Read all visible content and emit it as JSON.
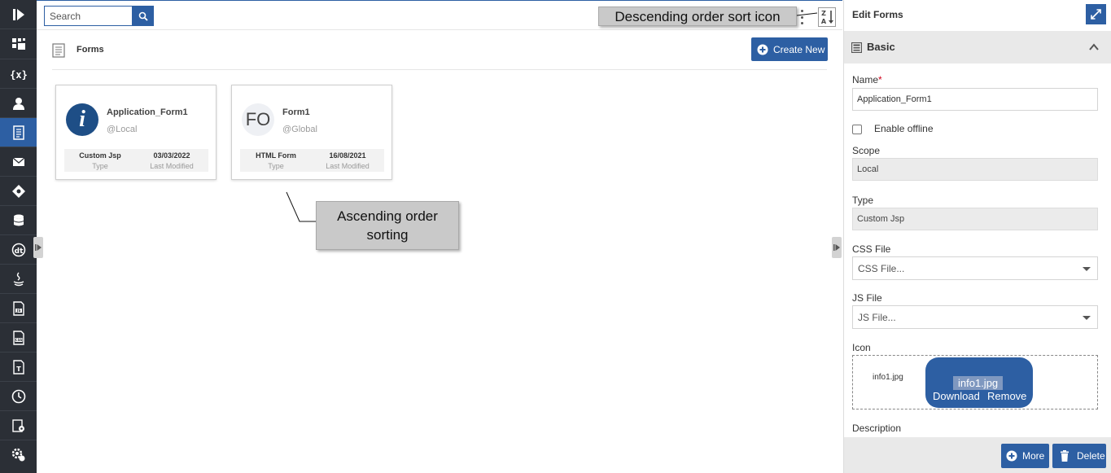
{
  "search": {
    "placeholder": "Search"
  },
  "nav": {
    "items": [
      {
        "icon": "play-icon"
      },
      {
        "icon": "dashboard-icon"
      },
      {
        "icon": "variables-icon"
      },
      {
        "icon": "user-icon"
      },
      {
        "icon": "forms-icon",
        "active": true
      },
      {
        "icon": "mail-icon"
      },
      {
        "icon": "diamond-icon"
      },
      {
        "icon": "database-icon"
      },
      {
        "icon": "dt-icon"
      },
      {
        "icon": "java-icon"
      },
      {
        "icon": "js-file-icon"
      },
      {
        "icon": "css-file-icon"
      },
      {
        "icon": "text-file-icon"
      },
      {
        "icon": "clock-icon"
      },
      {
        "icon": "settings-doc-icon"
      },
      {
        "icon": "gear-user-icon"
      }
    ]
  },
  "forms": {
    "title": "Forms",
    "create_label": "Create New",
    "cards": [
      {
        "name": "Application_Form1",
        "scope": "@Local",
        "type_value": "Custom Jsp",
        "type_label": "Type",
        "modified_value": "03/03/2022",
        "modified_label": "Last Modified",
        "avatar": "i"
      },
      {
        "name": "Form1",
        "scope": "@Global",
        "type_value": "HTML Form",
        "type_label": "Type",
        "modified_value": "16/08/2021",
        "modified_label": "Last Modified",
        "avatar": "FO"
      }
    ]
  },
  "callouts": {
    "sort_icon": "Descending order sort icon",
    "ascending": "Ascending order sorting"
  },
  "panel": {
    "title": "Edit Forms",
    "section": "Basic",
    "name_label": "Name",
    "name_required": "*",
    "name_value": "Application_Form1",
    "offline_label": "Enable offline",
    "scope_label": "Scope",
    "scope_value": "Local",
    "type_label": "Type",
    "type_value": "Custom Jsp",
    "css_label": "CSS File",
    "css_placeholder": "CSS File...",
    "js_label": "JS File",
    "js_placeholder": "JS File...",
    "icon_label": "Icon",
    "icon_file": "info1.jpg",
    "chip_name": "info1.jpg",
    "download_label": "Download",
    "remove_label": "Remove",
    "description_label": "Description",
    "more_label": "More",
    "delete_label": "Delete"
  },
  "colors": {
    "accent": "#2d5fa3",
    "nav_bg": "#2b2f36",
    "avatar_info": "#1e4e86",
    "required": "#d0021b"
  }
}
